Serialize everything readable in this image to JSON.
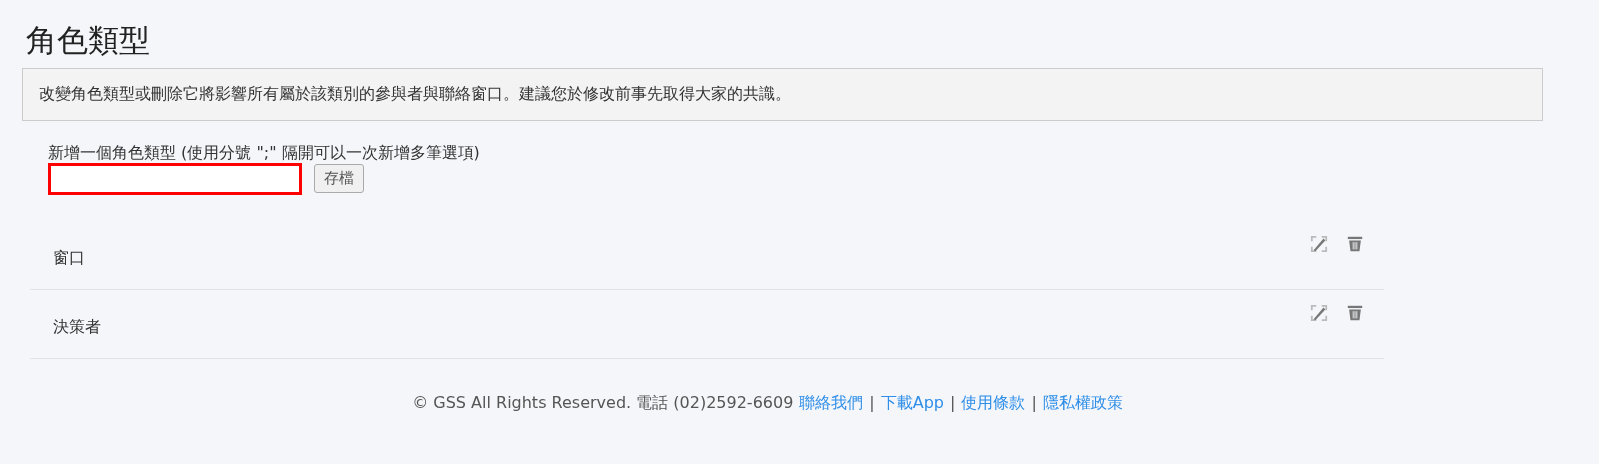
{
  "page": {
    "title": "角色類型"
  },
  "notice": "改變角色類型或刪除它將影響所有屬於該類別的參與者與聯絡窗口。建議您於修改前事先取得大家的共識。",
  "form": {
    "label": "新增一個角色類型  (使用分號 \";\" 隔開可以一次新增多筆選項)",
    "field": {
      "error": true
    },
    "save_button": "存檔"
  },
  "roles": [
    {
      "name": "窗口"
    },
    {
      "name": "決策者"
    }
  ],
  "footer": [
    {
      "kind": "text",
      "text": "© GSS All Rights Reserved. 電話 (02)2592-6609"
    },
    {
      "kind": "link",
      "text": "聯絡我們"
    },
    {
      "kind": "separator",
      "text": "|"
    },
    {
      "kind": "link",
      "text": "下載App"
    },
    {
      "kind": "separator",
      "text": "|"
    },
    {
      "kind": "link",
      "text": "使用條款"
    },
    {
      "kind": "separator",
      "text": "|"
    },
    {
      "kind": "link",
      "text": "隱私權政策"
    }
  ]
}
